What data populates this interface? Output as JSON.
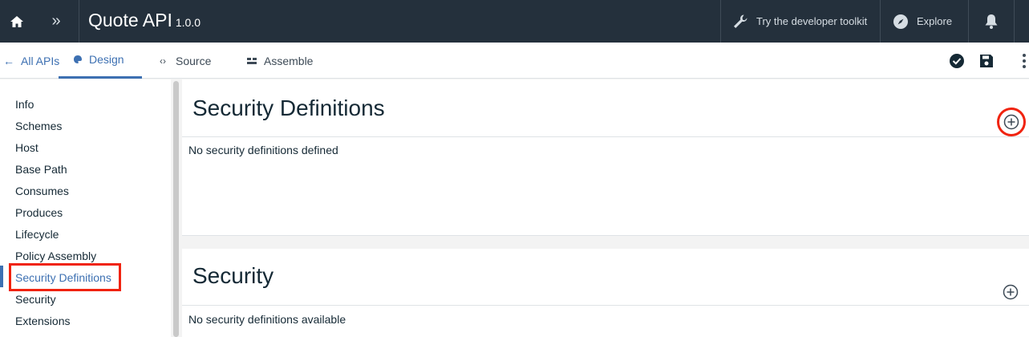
{
  "header": {
    "title": "Quote API",
    "version": "1.0.0",
    "toolkit_label": "Try the developer toolkit",
    "explore_label": "Explore"
  },
  "subnav": {
    "back_label": "All APIs",
    "tabs": [
      {
        "label": "Design",
        "active": true
      },
      {
        "label": "Source",
        "active": false
      },
      {
        "label": "Assemble",
        "active": false
      }
    ]
  },
  "sidebar": {
    "items": [
      {
        "label": "Info"
      },
      {
        "label": "Schemes"
      },
      {
        "label": "Host"
      },
      {
        "label": "Base Path"
      },
      {
        "label": "Consumes"
      },
      {
        "label": "Produces"
      },
      {
        "label": "Lifecycle"
      },
      {
        "label": "Policy Assembly"
      },
      {
        "label": "Security Definitions",
        "active": true
      },
      {
        "label": "Security"
      },
      {
        "label": "Extensions"
      }
    ]
  },
  "sections": [
    {
      "title": "Security Definitions",
      "message": "No security definitions defined"
    },
    {
      "title": "Security",
      "message": "No security definitions available"
    }
  ],
  "colors": {
    "header_bg": "#24303c",
    "accent": "#3d70b2",
    "highlight": "#f0230f"
  },
  "icons": [
    "home-icon",
    "expand-icon",
    "wrench-icon",
    "compass-icon",
    "bell-icon",
    "arrow-left-icon",
    "palette-icon",
    "code-icon",
    "assemble-icon",
    "validate-icon",
    "save-icon",
    "more-vertical-icon",
    "add-circle-icon"
  ]
}
